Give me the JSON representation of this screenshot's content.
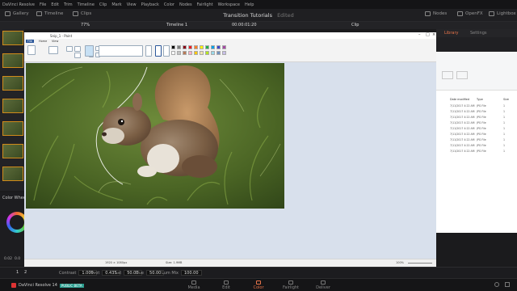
{
  "app": {
    "title": "DaVinci Resolve",
    "menu": [
      "File",
      "Edit",
      "Trim",
      "Timeline",
      "Clip",
      "Mark",
      "View",
      "Playback",
      "Color",
      "Nodes",
      "Fairlight",
      "Workspace",
      "Help"
    ]
  },
  "toolbar": {
    "gallery": "Gallery",
    "timeline": "Timeline",
    "clips": "Clips",
    "project_title": "Transition Tutorials",
    "edited": "Edited",
    "nodes": "Nodes",
    "openfx": "OpenFX",
    "lightbox": "Lightbox"
  },
  "toolbar2": {
    "zoom": "77%",
    "timeline_name": "Timeline 1",
    "timecode": "00:00:01:20",
    "clip": "Clip"
  },
  "right_panel": {
    "tabs": [
      "Library",
      "Settings"
    ],
    "active_tab": "Library"
  },
  "color_wheels": {
    "label": "Color Wheels",
    "values": [
      "0.02",
      "0.0"
    ]
  },
  "controls": {
    "page_numbers": [
      "1",
      "2"
    ],
    "contrast_label": "Contrast",
    "contrast_value": "1.000",
    "pivot_label": "Pivot",
    "pivot_value": "0.435",
    "sat_label": "Sat",
    "sat_value": "50.00",
    "hue_label": "Hue",
    "hue_value": "50.00",
    "lummix_label": "Lum Mix",
    "lummix_value": "100.00"
  },
  "pages": {
    "brand": "DaVinci Resolve 14",
    "beta": "PUBLIC BETA",
    "tabs": [
      "Media",
      "Edit",
      "Color",
      "Fairlight",
      "Deliver"
    ],
    "active": "Color"
  },
  "paint": {
    "title": "Snip_1 - Paint",
    "menu_file": "File",
    "tab_home": "Home",
    "tab_view": "View",
    "status_dims": "1920 × 1080px",
    "status_size": "Size: 1.9MB",
    "status_zoom": "100%"
  },
  "explorer": {
    "headers": [
      "Date modified",
      "Type",
      "Size"
    ],
    "rows": [
      {
        "date": "7/11/2017 4:22 AM",
        "type": "JPG File",
        "size": "1"
      },
      {
        "date": "7/11/2017 4:22 AM",
        "type": "JPG File",
        "size": "1"
      },
      {
        "date": "7/11/2017 4:22 AM",
        "type": "JPG File",
        "size": "1"
      },
      {
        "date": "7/11/2017 4:22 AM",
        "type": "JPG File",
        "size": "1"
      },
      {
        "date": "7/11/2017 4:22 AM",
        "type": "JPG File",
        "size": "1"
      },
      {
        "date": "7/11/2017 4:22 AM",
        "type": "JPG File",
        "size": "1"
      },
      {
        "date": "7/11/2017 4:22 AM",
        "type": "JPG File",
        "size": "1"
      },
      {
        "date": "7/11/2017 4:22 AM",
        "type": "JPG File",
        "size": "1"
      },
      {
        "date": "7/11/2017 4:22 AM",
        "type": "JPG File",
        "size": "1"
      }
    ]
  },
  "palette": [
    "#000000",
    "#7f7f7f",
    "#880015",
    "#ed1c24",
    "#ff7f27",
    "#fff200",
    "#22b14c",
    "#00a2e8",
    "#3f48cc",
    "#a349a4",
    "#ffffff",
    "#c3c3c3",
    "#b97a57",
    "#ffaec9",
    "#ffc90e",
    "#efe4b0",
    "#b5e61d",
    "#99d9ea",
    "#7092be",
    "#c8bfe7"
  ]
}
